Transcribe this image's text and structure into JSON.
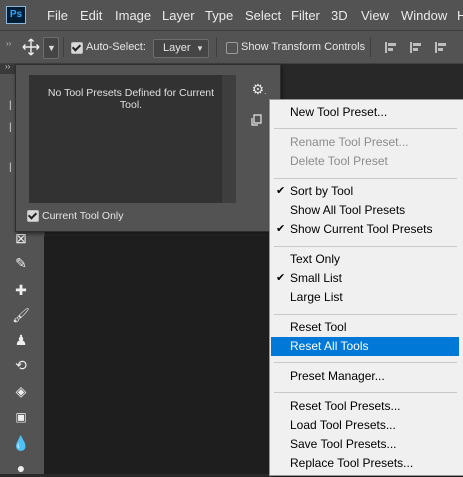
{
  "menubar": {
    "logo": "Ps",
    "items": [
      "File",
      "Edit",
      "Image",
      "Layer",
      "Type",
      "Select",
      "Filter",
      "3D",
      "View",
      "Window",
      "H"
    ]
  },
  "options_bar": {
    "auto_select_label": "Auto-Select:",
    "auto_select_checked": true,
    "layer_select_value": "Layer",
    "show_transform_controls_label": "Show Transform Controls",
    "show_transform_controls_checked": false
  },
  "tool_presets_panel": {
    "empty_message": "No Tool Presets Defined for Current Tool.",
    "current_tool_only_label": "Current Tool Only",
    "current_tool_only_checked": true
  },
  "context_menu": {
    "groups": [
      [
        {
          "label": "New Tool Preset...",
          "enabled": true,
          "checked": false
        }
      ],
      [
        {
          "label": "Rename Tool Preset...",
          "enabled": false,
          "checked": false
        },
        {
          "label": "Delete Tool Preset",
          "enabled": false,
          "checked": false
        }
      ],
      [
        {
          "label": "Sort by Tool",
          "enabled": true,
          "checked": true
        },
        {
          "label": "Show All Tool Presets",
          "enabled": true,
          "checked": false
        },
        {
          "label": "Show Current Tool Presets",
          "enabled": true,
          "checked": true
        }
      ],
      [
        {
          "label": "Text Only",
          "enabled": true,
          "checked": false
        },
        {
          "label": "Small List",
          "enabled": true,
          "checked": true
        },
        {
          "label": "Large List",
          "enabled": true,
          "checked": false
        }
      ],
      [
        {
          "label": "Reset Tool",
          "enabled": true,
          "checked": false
        },
        {
          "label": "Reset All Tools",
          "enabled": true,
          "checked": false,
          "highlighted": true
        }
      ],
      [
        {
          "label": "Preset Manager...",
          "enabled": true,
          "checked": false
        }
      ],
      [
        {
          "label": "Reset Tool Presets...",
          "enabled": true,
          "checked": false
        },
        {
          "label": "Load Tool Presets...",
          "enabled": true,
          "checked": false
        },
        {
          "label": "Save Tool Presets...",
          "enabled": true,
          "checked": false
        },
        {
          "label": "Replace Tool Presets...",
          "enabled": true,
          "checked": false
        }
      ]
    ]
  },
  "toolbar_icons": [
    "frame-tool-icon",
    "eyedropper-tool-icon",
    "healing-brush-tool-icon",
    "brush-tool-icon",
    "clone-stamp-tool-icon",
    "history-brush-tool-icon",
    "eraser-tool-icon",
    "gradient-tool-icon",
    "blur-tool-icon",
    "dodge-tool-icon"
  ],
  "colors": {
    "highlight": "#0078d7",
    "menu_background": "#f0f0f0",
    "ui_gray": "#535353"
  }
}
